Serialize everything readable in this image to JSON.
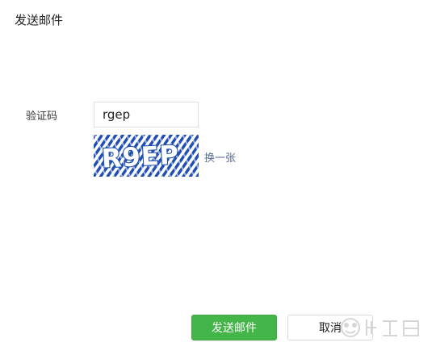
{
  "dialog": {
    "title": "发送邮件"
  },
  "form": {
    "captcha_label": "验证码",
    "captcha_value": "rgep",
    "captcha_image_text": "R9EP",
    "refresh_label": "换一张"
  },
  "buttons": {
    "send_label": "发送邮件",
    "cancel_label": "取消"
  },
  "colors": {
    "primary": "#44b549",
    "link": "#576b95",
    "captcha_blue": "#1f4fb3"
  },
  "icons": {
    "watermark": "baidu-jingyan-watermark-icon"
  }
}
